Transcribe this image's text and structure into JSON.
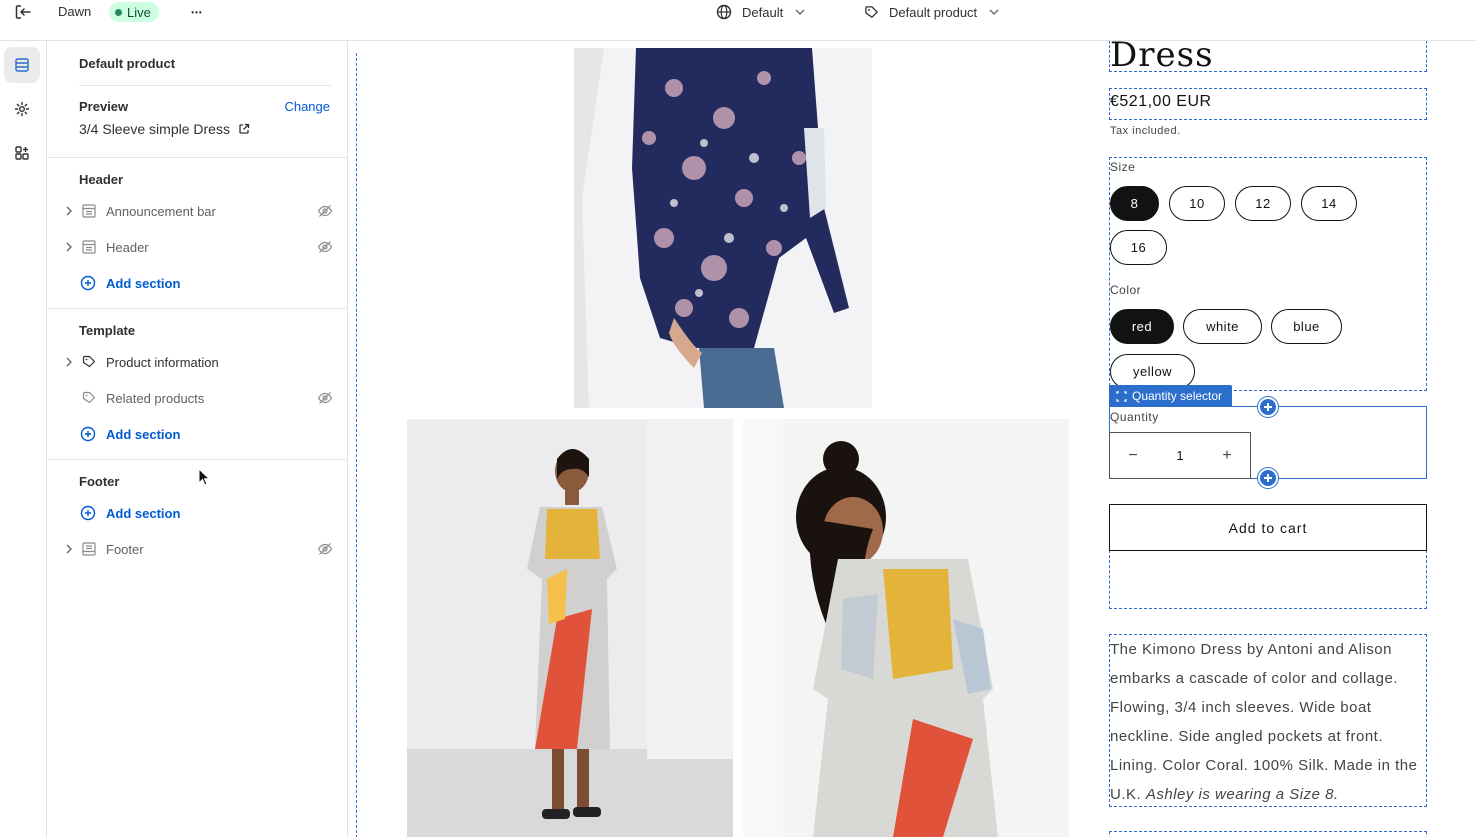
{
  "topbar": {
    "theme_name": "Dawn",
    "live_badge": "Live",
    "more": "•••",
    "locale_select": "Default",
    "template_select": "Default product"
  },
  "sidebar": {
    "title": "Default product",
    "preview": {
      "label": "Preview",
      "change": "Change",
      "value": "3/4 Sleeve simple Dress"
    },
    "header_group": {
      "title": "Header",
      "items": [
        {
          "label": "Announcement bar"
        },
        {
          "label": "Header"
        }
      ],
      "add_section": "Add section"
    },
    "template_group": {
      "title": "Template",
      "items": [
        {
          "label": "Product information"
        },
        {
          "label": "Related products"
        }
      ],
      "add_section": "Add section"
    },
    "footer_group": {
      "title": "Footer",
      "add_section": "Add section",
      "items": [
        {
          "label": "Footer"
        }
      ]
    }
  },
  "product": {
    "title": "Dress",
    "price": "€521,00 EUR",
    "tax_note": "Tax included.",
    "size_label": "Size",
    "sizes": [
      "8",
      "10",
      "12",
      "14",
      "16"
    ],
    "selected_size": "8",
    "color_label": "Color",
    "colors": [
      "red",
      "white",
      "blue",
      "yellow"
    ],
    "selected_color": "red",
    "quantity_tag": "Quantity selector",
    "quantity_label": "Quantity",
    "quantity_minus": "−",
    "quantity_value": "1",
    "quantity_plus": "+",
    "add_to_cart": "Add to cart",
    "description": "The Kimono Dress by Antoni and Alison embarks a cascade of color and collage. Flowing, 3/4 inch sleeves. Wide boat neckline. Side angled pockets at front. Lining. Color Coral. 100% Silk. Made in the U.K.",
    "description_italic": "Ashley is wearing a Size 8."
  },
  "colors": {
    "accent_blue": "#2c6ecb",
    "link_blue": "#005bd3",
    "live_green": "#29845a",
    "selected_pill": "#121212"
  }
}
